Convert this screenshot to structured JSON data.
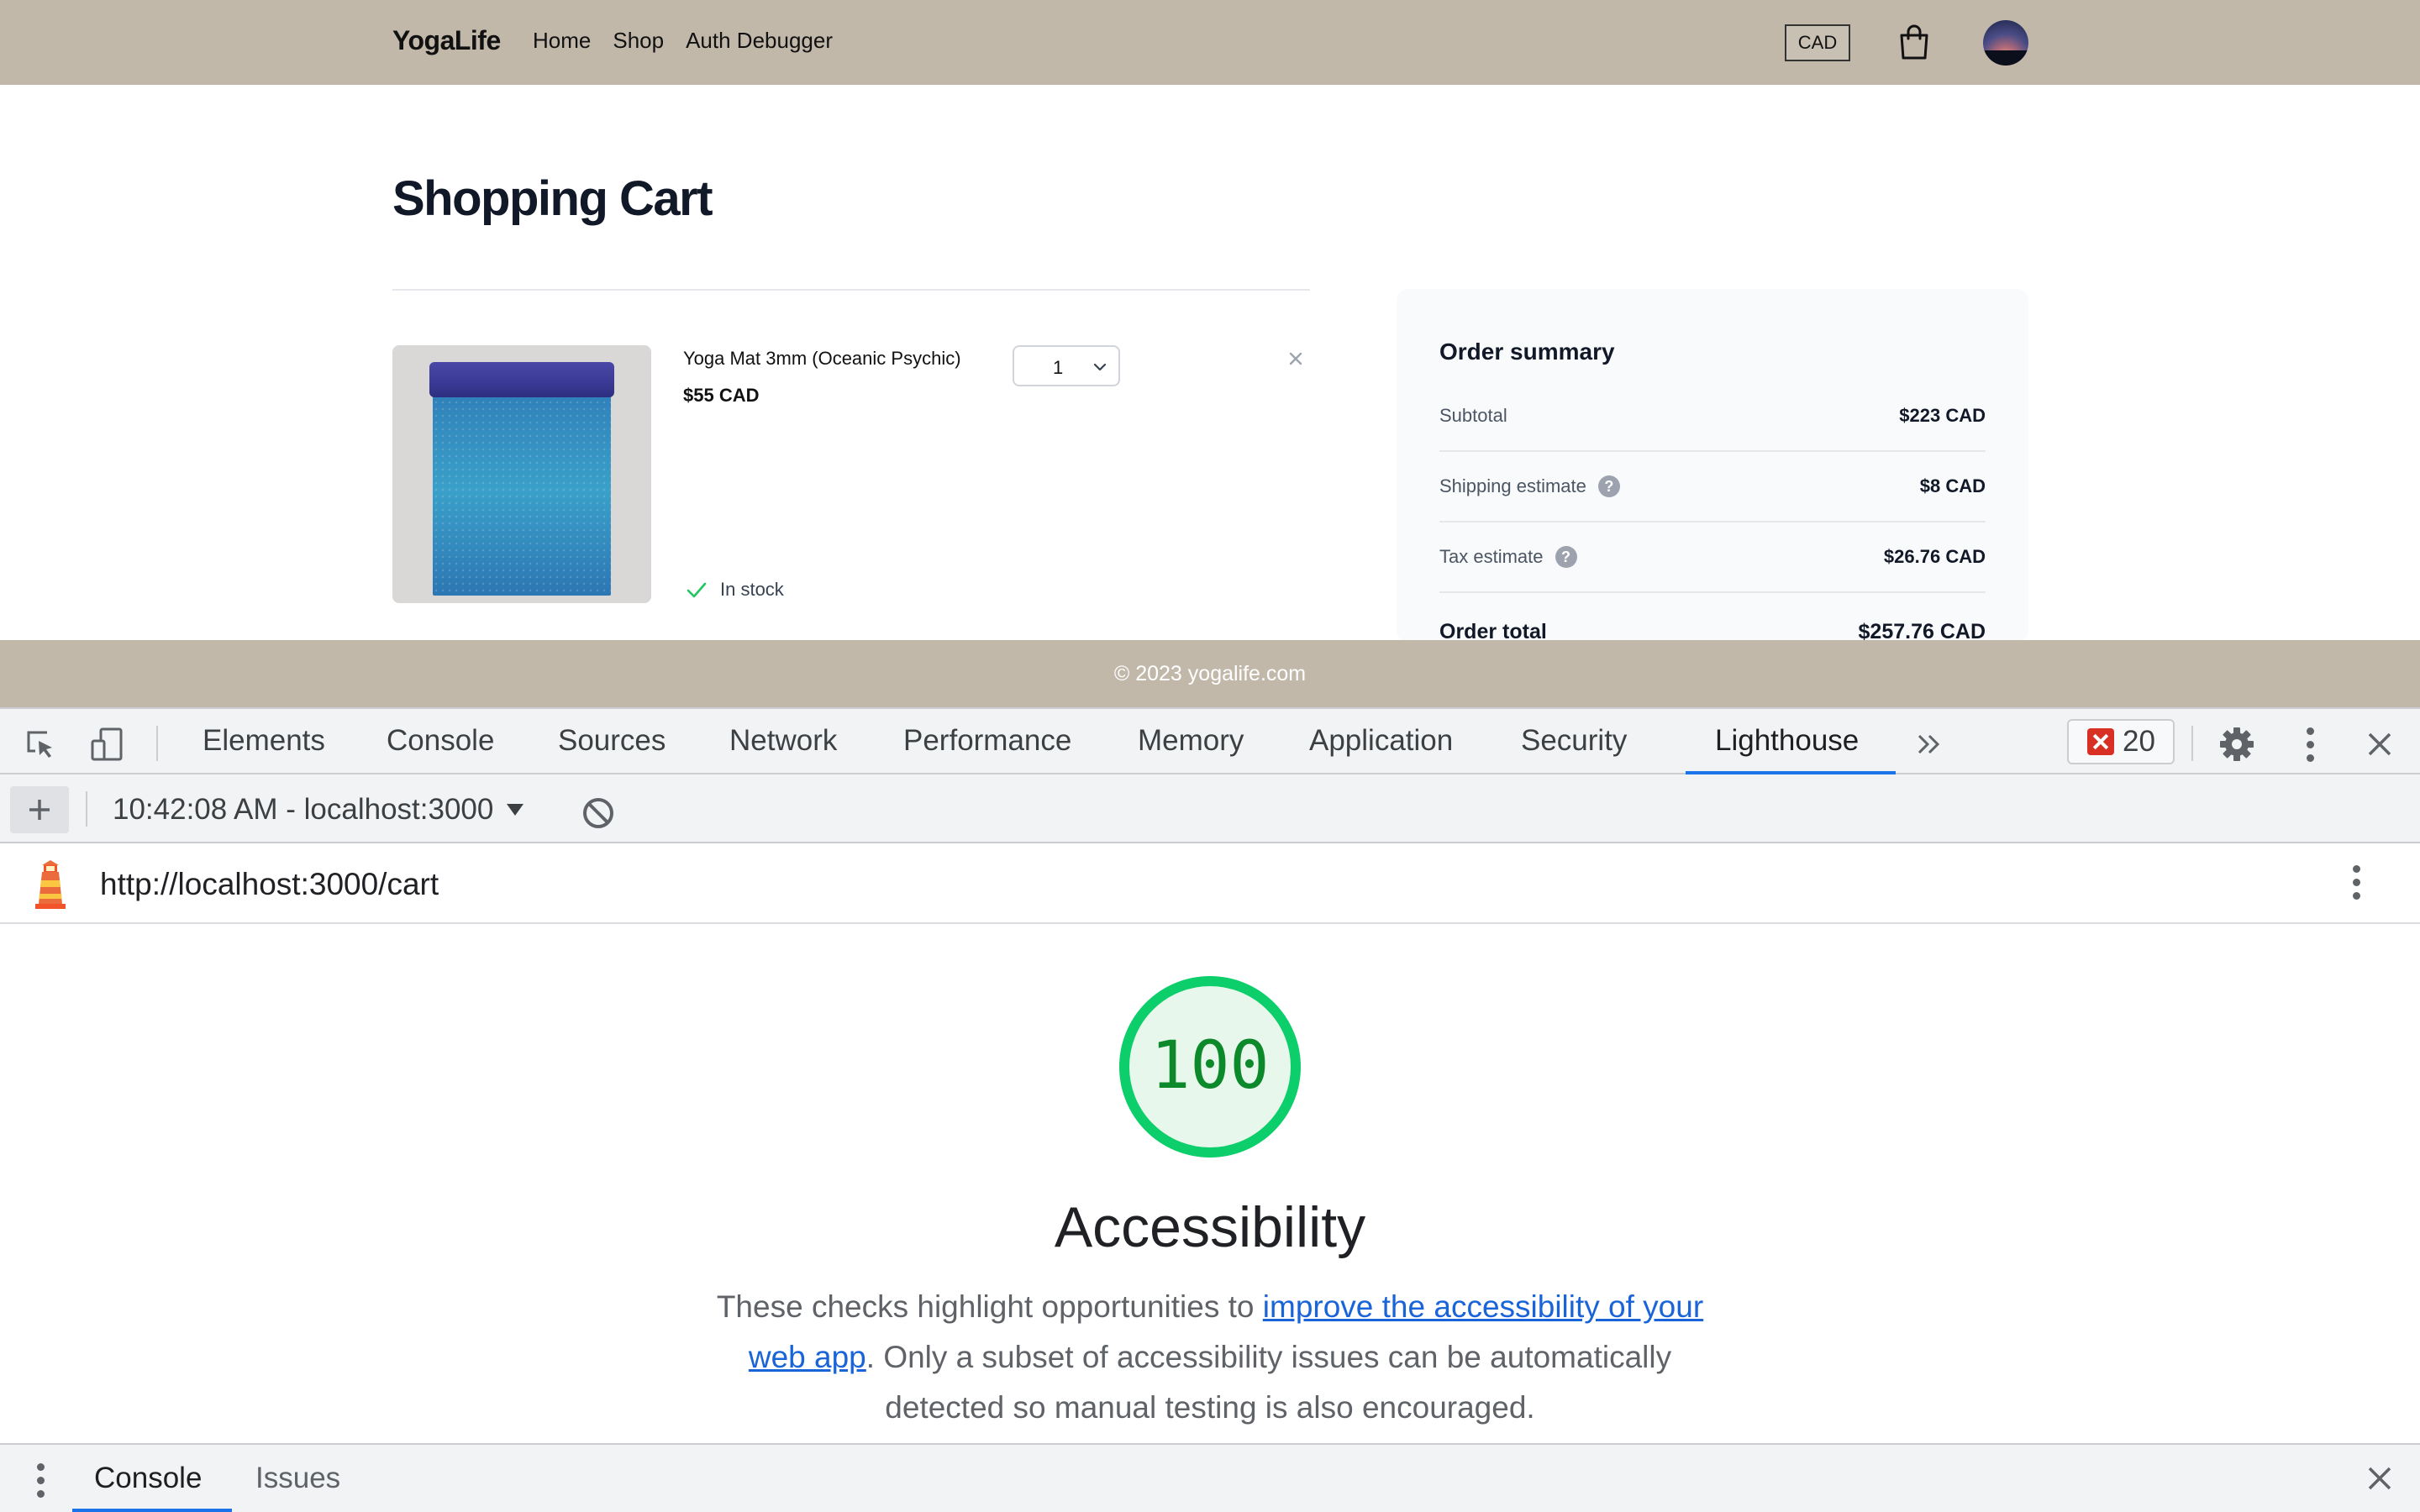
{
  "site": {
    "brand": "YogaLife",
    "nav": [
      "Home",
      "Shop",
      "Auth Debugger"
    ],
    "currency": "CAD",
    "footer": "© 2023 yogalife.com"
  },
  "cart": {
    "title": "Shopping Cart",
    "item": {
      "name": "Yoga Mat 3mm (Oceanic Psychic)",
      "price": "$55 CAD",
      "quantity": "1",
      "stock_status": "In stock"
    },
    "summary": {
      "title": "Order summary",
      "subtotal_label": "Subtotal",
      "subtotal_value": "$223 CAD",
      "shipping_label": "Shipping estimate",
      "shipping_value": "$8 CAD",
      "tax_label": "Tax estimate",
      "tax_value": "$26.76 CAD",
      "total_label": "Order total",
      "total_value": "$257.76 CAD"
    }
  },
  "devtools": {
    "tabs": [
      "Elements",
      "Console",
      "Sources",
      "Network",
      "Performance",
      "Memory",
      "Application",
      "Security",
      "Lighthouse"
    ],
    "active_tab": "Lighthouse",
    "error_count": "20",
    "report_label": "10:42:08 AM - localhost:3000",
    "url": "http://localhost:3000/cart",
    "score": "100",
    "score_fraction": 1.0,
    "category_title": "Accessibility",
    "description_prefix": "These checks highlight opportunities to ",
    "description_link": "improve the accessibility of your web app",
    "description_suffix": ". Only a subset of accessibility issues can be automatically detected so manual testing is also encouraged.",
    "drawer_tabs": [
      "Console",
      "Issues"
    ],
    "colors": {
      "accent": "#1a73e8",
      "pass": "#0cce6b",
      "pass_text": "#0c8a2b",
      "error": "#d93025"
    }
  }
}
